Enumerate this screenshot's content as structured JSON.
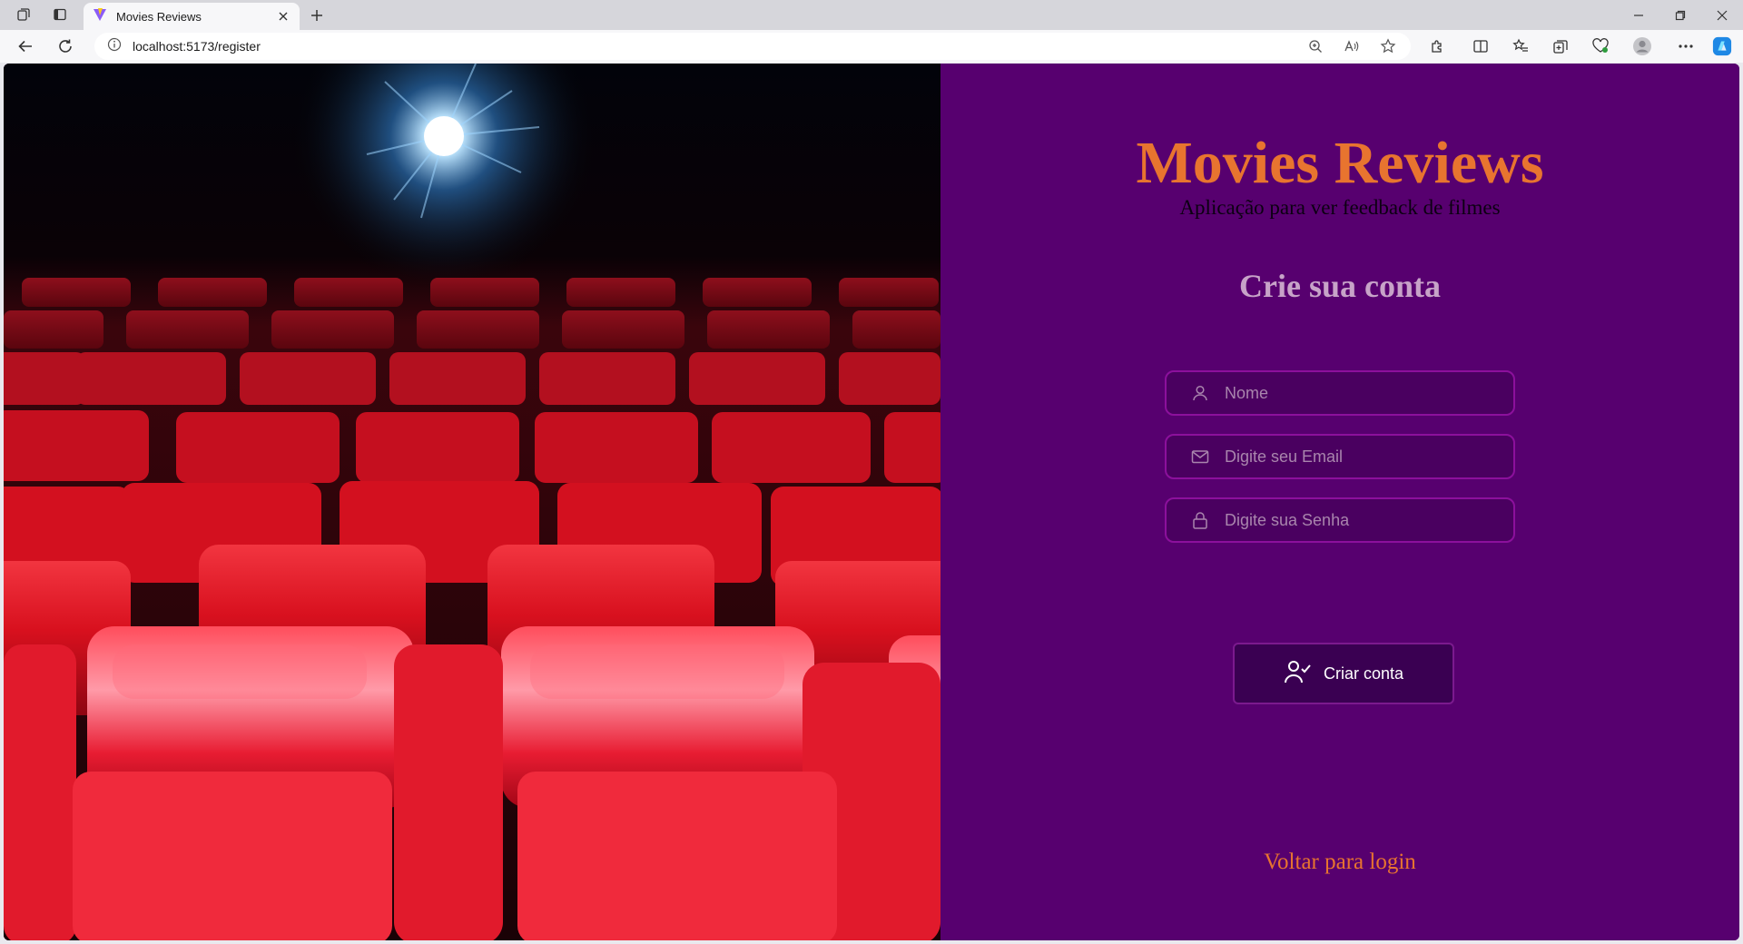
{
  "browser": {
    "tab_title": "Movies Reviews",
    "url": "localhost:5173/register"
  },
  "page": {
    "app_title": "Movies Reviews",
    "app_subtitle": "Aplicação para ver feedback de filmes",
    "form_title": "Crie sua conta",
    "fields": {
      "name_placeholder": "Nome",
      "email_placeholder": "Digite seu Email",
      "password_placeholder": "Digite sua Senha"
    },
    "submit_label": "Criar conta",
    "back_link": "Voltar para login"
  },
  "colors": {
    "panel_bg": "#57006f",
    "accent": "#e8742f",
    "field_border": "#8c109c",
    "seat_red": "#d8101e"
  },
  "icons": {
    "name_field": "user-icon",
    "email_field": "mail-icon",
    "password_field": "lock-icon",
    "submit": "user-check-icon"
  }
}
